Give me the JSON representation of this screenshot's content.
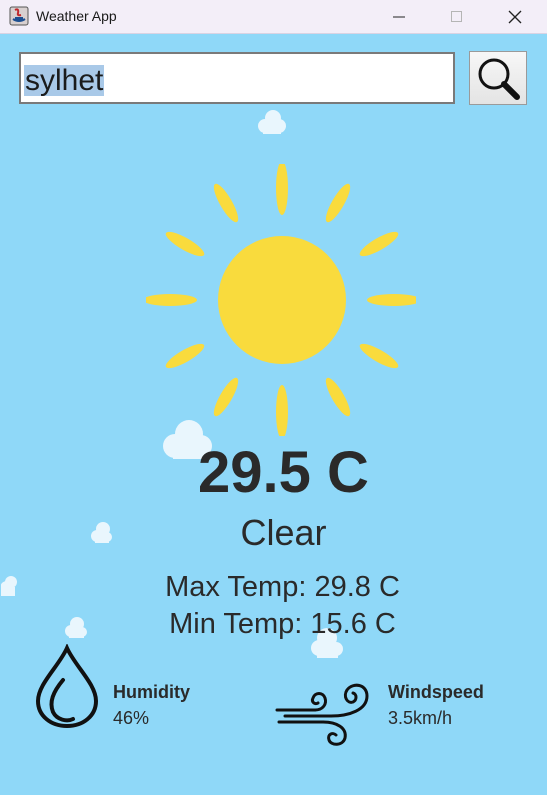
{
  "window": {
    "title": "Weather App",
    "icon": "java-app-icon",
    "controls": [
      "minimize-icon",
      "maximize-icon",
      "close-icon"
    ]
  },
  "search": {
    "value": "sylhet",
    "button_icon": "search-icon"
  },
  "weather": {
    "icon": "sun-icon",
    "temperature": "29.5 C",
    "condition": "Clear",
    "max_temp": "Max Temp: 29.8 C",
    "min_temp": "Min Temp: 15.6 C"
  },
  "humidity": {
    "icon": "humidity-drop-icon",
    "label": "Humidity",
    "value": "46%"
  },
  "windspeed": {
    "icon": "wind-icon",
    "label": "Windspeed",
    "value": "3.5km/h"
  },
  "colors": {
    "background": "#8fd8f8",
    "sun": "#f9db3d",
    "text": "#2a2a2a"
  }
}
